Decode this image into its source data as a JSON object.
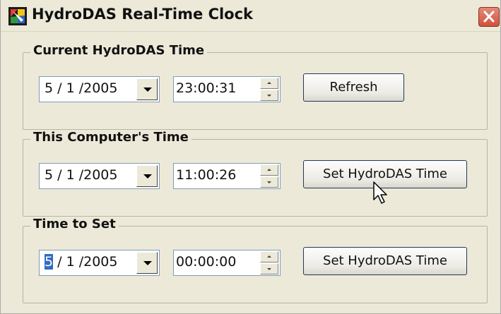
{
  "window": {
    "title": "HydroDAS Real-Time Clock"
  },
  "groups": [
    {
      "label": "Current HydroDAS Time",
      "date": {
        "month": "5",
        "day": "1",
        "year": "2005"
      },
      "time": "23:00:31",
      "button_label": "Refresh"
    },
    {
      "label": "This Computer's Time",
      "date": {
        "month": "5",
        "day": "1",
        "year": "2005"
      },
      "time": "11:00:26",
      "button_label": "Set HydroDAS Time"
    },
    {
      "label": "Time to Set",
      "date": {
        "month": "5",
        "day": "1",
        "year": "2005"
      },
      "time": "00:00:00",
      "button_label": "Set HydroDAS Time"
    }
  ],
  "icons": {
    "app": "hydrodas-app-icon",
    "close": "close-icon",
    "dropdown": "chevron-down-icon",
    "spin_up": "spin-up-icon",
    "spin_down": "spin-down-icon",
    "cursor": "mouse-pointer-icon"
  },
  "colors": {
    "window_bg": "#ece9d8",
    "close_button": "#d0513d",
    "selection": "#316ac5",
    "button_border": "#1e395b"
  }
}
